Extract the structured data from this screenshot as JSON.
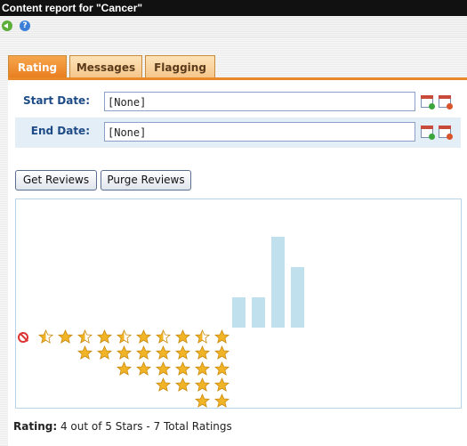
{
  "window": {
    "title": "Content report for \"Cancer\""
  },
  "nav": {
    "back_icon": "back-arrow-icon",
    "help_icon": "help-icon"
  },
  "tabs": [
    {
      "label": "Rating",
      "active": true
    },
    {
      "label": "Messages",
      "active": false
    },
    {
      "label": "Flagging",
      "active": false
    }
  ],
  "form": {
    "start_label": "Start Date:",
    "start_value": "[None]",
    "end_label": "End Date:",
    "end_value": "[None]"
  },
  "buttons": {
    "get": "Get Reviews",
    "purge": "Purge Reviews"
  },
  "chart_data": {
    "type": "bar",
    "categories": [
      "No rating",
      "0.5",
      "1",
      "1.5",
      "2",
      "2.5",
      "3",
      "3.5",
      "4",
      "4.5",
      "5"
    ],
    "values": [
      0,
      0,
      0,
      0,
      0,
      0,
      1,
      1,
      3,
      2,
      0
    ],
    "ylim": [
      0,
      3
    ],
    "colors": {
      "bar": "#bfe0ec",
      "star": "#f1b426",
      "no_rating": "#d33333"
    }
  },
  "summary": {
    "label": "Rating:",
    "text": "4 out of 5 Stars - 7 Total Ratings"
  }
}
